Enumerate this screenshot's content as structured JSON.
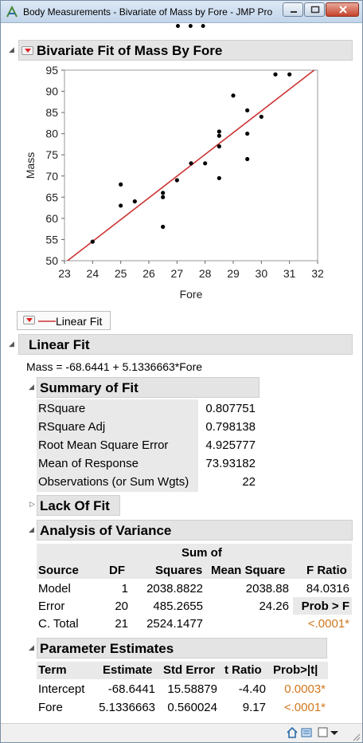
{
  "window": {
    "title": "Body Measurements - Bivariate of Mass by Fore - JMP Pro",
    "minimize": "–",
    "maximize": "□",
    "close": "✕",
    "more": "• • •"
  },
  "bivariate": {
    "title": "Bivariate Fit of Mass By Fore"
  },
  "chart_data": {
    "type": "scatter",
    "xlabel": "Fore",
    "ylabel": "Mass",
    "xlim": [
      23,
      32
    ],
    "ylim": [
      50,
      95
    ],
    "xticks": [
      "23",
      "24",
      "25",
      "26",
      "27",
      "28",
      "29",
      "30",
      "31",
      "32"
    ],
    "yticks": [
      "50",
      "55",
      "60",
      "65",
      "70",
      "75",
      "80",
      "85",
      "90",
      "95"
    ],
    "points": [
      [
        24,
        54.5
      ],
      [
        25,
        68
      ],
      [
        25,
        63
      ],
      [
        25.5,
        64
      ],
      [
        26.5,
        66
      ],
      [
        26.5,
        65
      ],
      [
        26.5,
        58
      ],
      [
        27,
        69
      ],
      [
        27.5,
        73
      ],
      [
        28,
        73
      ],
      [
        28.5,
        80.5
      ],
      [
        28.5,
        79.5
      ],
      [
        28.5,
        77
      ],
      [
        28.5,
        69.5
      ],
      [
        29,
        89
      ],
      [
        29.5,
        85.5
      ],
      [
        29.5,
        80
      ],
      [
        29.5,
        74
      ],
      [
        30,
        84
      ],
      [
        30.5,
        94
      ],
      [
        31,
        94
      ]
    ],
    "fit_line": {
      "intercept": -68.6441,
      "slope": 5.1336663,
      "color": "#cc3333"
    },
    "grid": false
  },
  "legend": {
    "label": "Linear Fit"
  },
  "linear_fit": {
    "title": "Linear Fit",
    "equation": "Mass = -68.6441 + 5.1336663*Fore"
  },
  "summary": {
    "title": "Summary of Fit",
    "rows": [
      {
        "label": "RSquare",
        "value": "0.807751"
      },
      {
        "label": "RSquare Adj",
        "value": "0.798138"
      },
      {
        "label": "Root Mean Square Error",
        "value": "4.925777"
      },
      {
        "label": "Mean of Response",
        "value": "73.93182"
      },
      {
        "label": "Observations (or Sum Wgts)",
        "value": "22"
      }
    ]
  },
  "lack_of_fit": {
    "title": "Lack Of Fit"
  },
  "anova": {
    "title": "Analysis of Variance",
    "headers": {
      "source": "Source",
      "df": "DF",
      "ss_top": "Sum of",
      "ss": "Squares",
      "ms": "Mean Square",
      "f": "F Ratio"
    },
    "rows": [
      {
        "source": "Model",
        "df": "1",
        "ss": "2038.8822",
        "ms": "2038.88",
        "f": "84.0316"
      },
      {
        "source": "Error",
        "df": "20",
        "ss": "485.2655",
        "ms": "24.26",
        "f": "Prob > F"
      },
      {
        "source": "C. Total",
        "df": "21",
        "ss": "2524.1477",
        "ms": "",
        "f": "<.0001*"
      }
    ]
  },
  "params": {
    "title": "Parameter Estimates",
    "headers": {
      "term": "Term",
      "est": "Estimate",
      "se": "Std Error",
      "t": "t Ratio",
      "p": "Prob>|t|"
    },
    "rows": [
      {
        "term": "Intercept",
        "est": "-68.6441",
        "se": "15.58879",
        "t": "-4.40",
        "p": "0.0003*"
      },
      {
        "term": "Fore",
        "est": "5.1336663",
        "se": "0.560024",
        "t": "9.17",
        "p": "<.0001*"
      }
    ]
  }
}
